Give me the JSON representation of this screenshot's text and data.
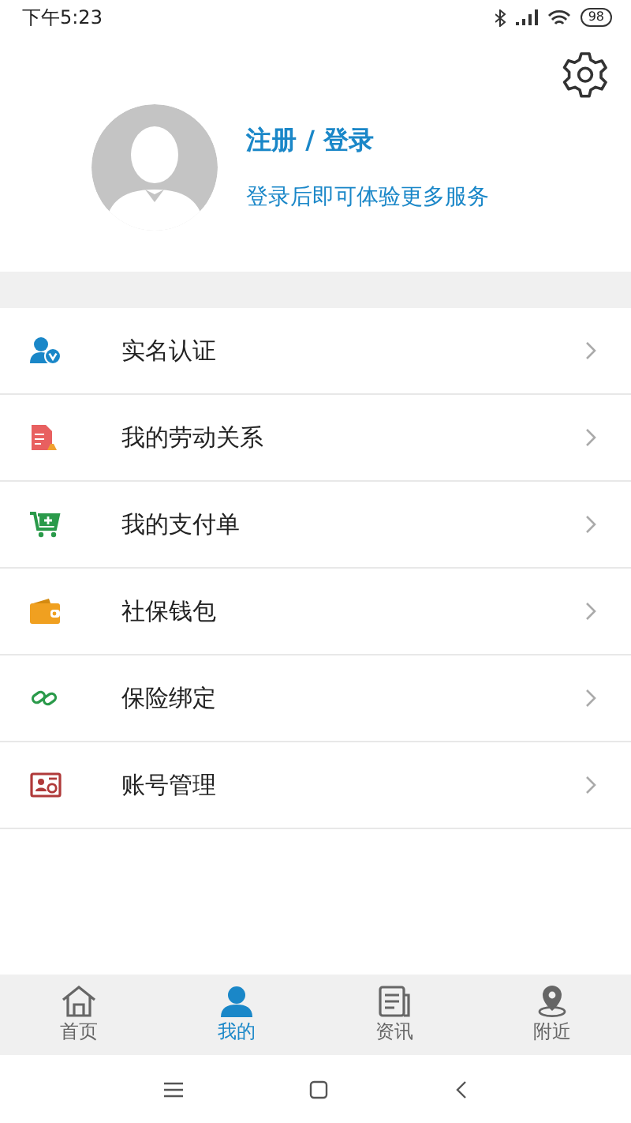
{
  "status_bar": {
    "time": "下午5:23",
    "battery": "98"
  },
  "profile": {
    "title": "注册 / 登录",
    "subtitle": "登录后即可体验更多服务"
  },
  "menu": [
    {
      "label": "实名认证"
    },
    {
      "label": "我的劳动关系"
    },
    {
      "label": "我的支付单"
    },
    {
      "label": "社保钱包"
    },
    {
      "label": "保险绑定"
    },
    {
      "label": "账号管理"
    }
  ],
  "tabs": [
    {
      "label": "首页",
      "selected": false
    },
    {
      "label": "我的",
      "selected": true
    },
    {
      "label": "资讯",
      "selected": false
    },
    {
      "label": "附近",
      "selected": false
    }
  ]
}
